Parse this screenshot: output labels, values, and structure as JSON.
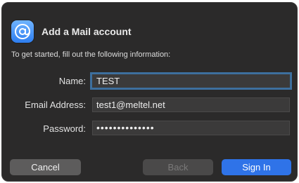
{
  "dialog": {
    "title": "Add a Mail account",
    "icon": "at-sign-icon",
    "intro": "To get started, fill out the following information:"
  },
  "form": {
    "name_label": "Name:",
    "name_value": "TEST",
    "email_label": "Email Address:",
    "email_value": "test1@meltel.net",
    "password_label": "Password:",
    "password_value": "••••••••••••••"
  },
  "buttons": {
    "cancel": "Cancel",
    "back": "Back",
    "sign_in": "Sign In"
  },
  "colors": {
    "dialog_bg": "#2b2a2a",
    "accent": "#2f73e8",
    "focus_ring": "#3d6f9e"
  }
}
